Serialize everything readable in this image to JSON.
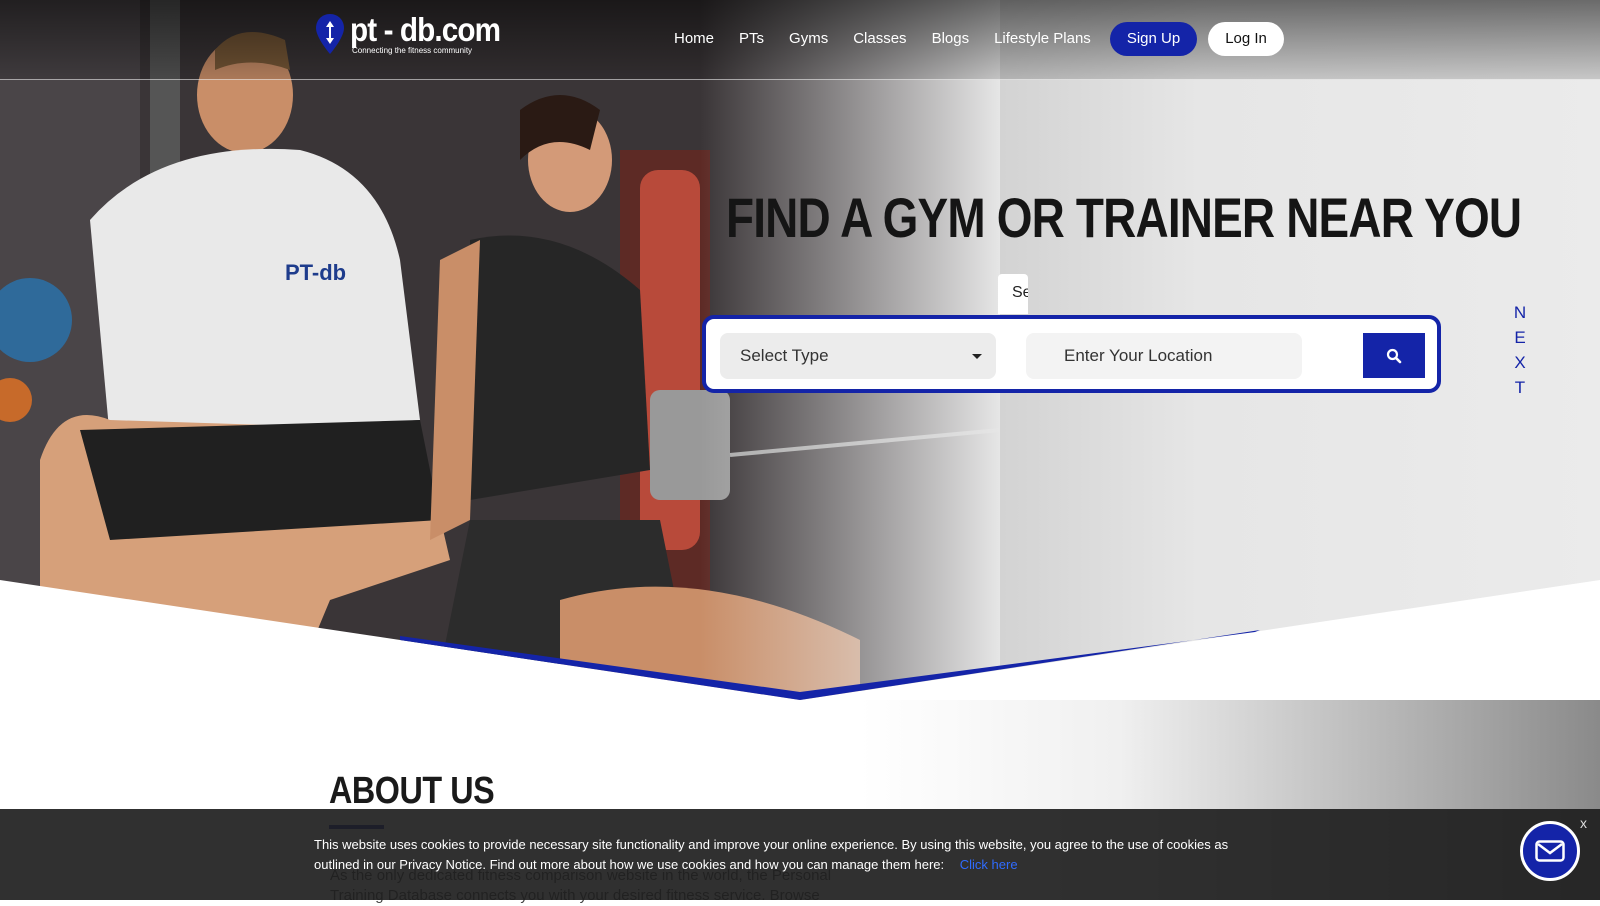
{
  "header": {
    "logo_title": "pt - db.com",
    "logo_tagline": "Connecting the fitness community",
    "nav": [
      {
        "label": "Home"
      },
      {
        "label": "PTs"
      },
      {
        "label": "Gyms"
      },
      {
        "label": "Classes"
      },
      {
        "label": "Blogs"
      },
      {
        "label": "Lifestyle Plans"
      }
    ],
    "signup_label": "Sign Up",
    "login_label": "Log In"
  },
  "hero": {
    "headline": "FIND A GYM OR TRAINER NEAR YOU",
    "tab_stub_text": "Se",
    "select_type_label": "Select Type",
    "location_placeholder": "Enter Your Location",
    "next_letters": [
      "N",
      "E",
      "X",
      "T"
    ],
    "shirt_logo_text": "PT-db"
  },
  "about": {
    "title": "ABOUT US",
    "text": "As the only dedicated fitness comparison website in the world, the Personal Training Database connects you with your desired fitness service. Browse"
  },
  "cookie_banner": {
    "text": "This website uses cookies to provide necessary site functionality and improve your online experience. By using this website, you agree to the use of cookies as outlined in our Privacy Notice. Find out more about how we use cookies and how you can manage them here:",
    "link_label": "Click here",
    "close_label": "x"
  },
  "icons": {
    "search": "search-icon",
    "chat": "mail-icon",
    "logo": "location-pin-icon"
  },
  "colors": {
    "brand_blue": "#1424a8",
    "cookie_bg": "#1e1e1e",
    "link_blue": "#2f6bff"
  }
}
